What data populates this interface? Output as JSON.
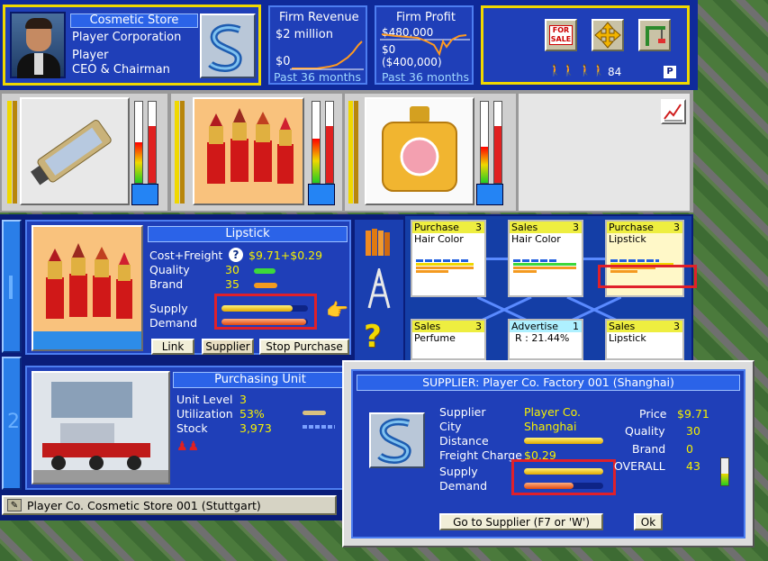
{
  "header": {
    "store_title": "Cosmetic Store",
    "corp_name": "Player Corporation",
    "player_name": "Player",
    "player_role": "CEO & Chairman",
    "revenue": {
      "title": "Firm Revenue",
      "value": "$2 million",
      "zero": "$0",
      "period": "Past 36 months"
    },
    "profit": {
      "title": "Firm Profit",
      "top": "$480,000",
      "zero": "$0",
      "bottom": "($400,000)",
      "period": "Past 36 months"
    },
    "for_sale_line1": "FOR",
    "for_sale_line2": "SALE",
    "staff_count": "84",
    "parking_label": "P"
  },
  "product": {
    "title": "Lipstick",
    "cost_label": "Cost+Freight",
    "cost_value": "$9.71+$0.29",
    "quality_label": "Quality",
    "quality_value": "30",
    "brand_label": "Brand",
    "brand_value": "35",
    "supply_label": "Supply",
    "demand_label": "Demand",
    "supply_level": 0.82,
    "demand_level": 0.98,
    "buttons": {
      "link": "Link",
      "supplier": "Supplier",
      "stop": "Stop Purchase"
    }
  },
  "unit": {
    "title": "Purchasing Unit",
    "level_label": "Unit Level",
    "level_value": "3",
    "util_label": "Utilization",
    "util_value": "53%",
    "stock_label": "Stock",
    "stock_value": "3,973"
  },
  "status_bar": {
    "text": "Player Co. Cosmetic Store 001 (Stuttgart)"
  },
  "grid": [
    {
      "title": "Purchase",
      "level": "3",
      "line": "Hair Color"
    },
    {
      "title": "Sales",
      "level": "3",
      "line": "Hair Color"
    },
    {
      "title": "Purchase",
      "level": "3",
      "line": "Lipstick"
    },
    {
      "title": "Sales",
      "level": "3",
      "line": "Perfume"
    },
    {
      "title": "Advertise",
      "level": "1",
      "line": "R : 21.44%"
    },
    {
      "title": "Sales",
      "level": "3",
      "line": "Lipstick"
    }
  ],
  "dialog": {
    "title": "SUPPLIER: Player Co. Factory 001 (Shanghai)",
    "supplier_label": "Supplier",
    "supplier_value": "Player Co.",
    "city_label": "City",
    "city_value": "Shanghai",
    "distance_label": "Distance",
    "freight_label": "Freight Charge",
    "freight_value": "$0.29",
    "supply_label": "Supply",
    "demand_label": "Demand",
    "supply_level": 1.0,
    "demand_level": 0.62,
    "price_label": "Price",
    "price_value": "$9.71",
    "quality_label": "Quality",
    "quality_value": "30",
    "brand_label": "Brand",
    "brand_value": "0",
    "overall_label": "OVERALL",
    "overall_value": "43",
    "goto_button": "Go to Supplier (F7 or 'W')",
    "ok_button": "Ok"
  },
  "colors": {
    "accent": "#f0d800",
    "panel": "#1f3fb8",
    "highlight": "#e0202a"
  }
}
